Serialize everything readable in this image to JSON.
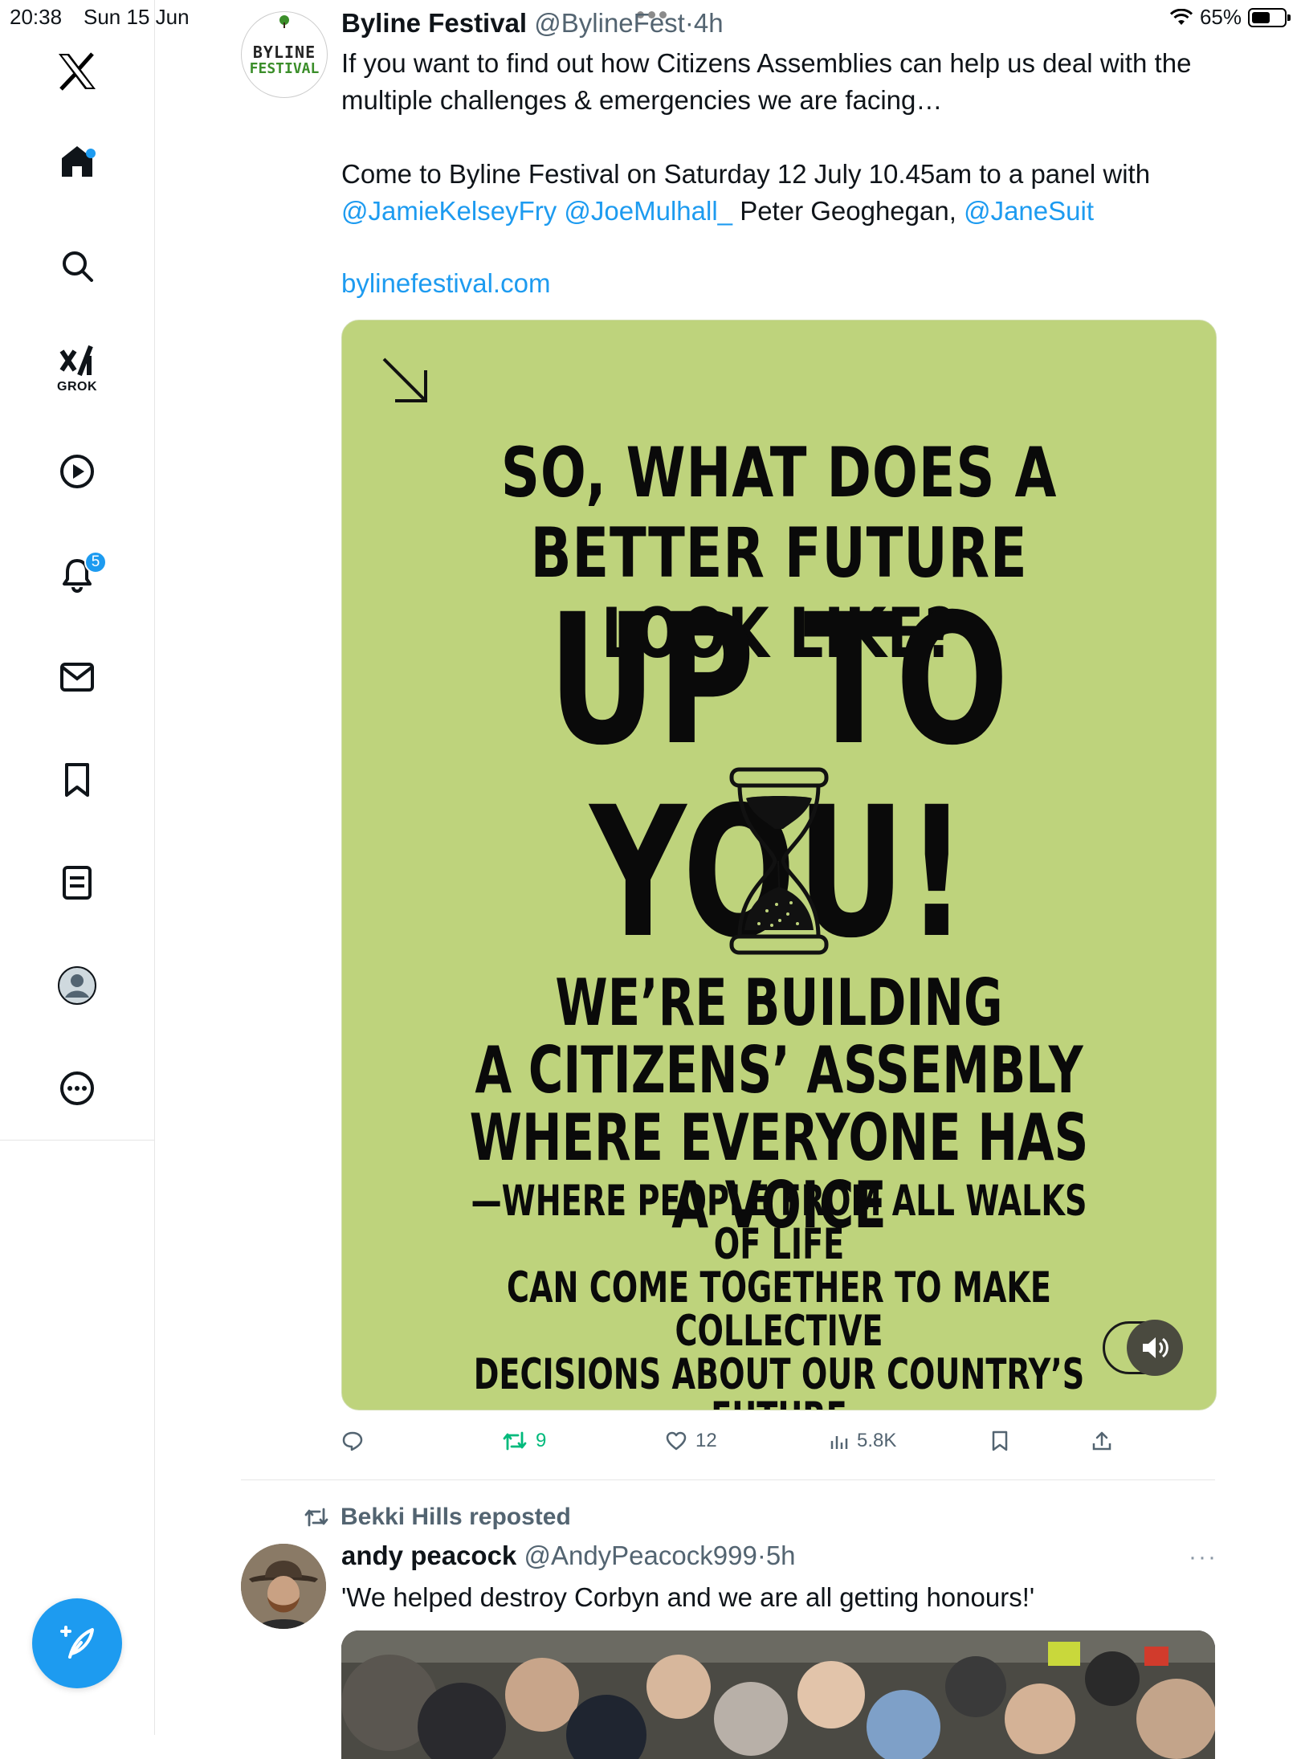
{
  "status_bar": {
    "time": "20:38",
    "date": "Sun 15 Jun",
    "battery": "65%",
    "battery_level": 0.65
  },
  "sidebar": {
    "items": [
      {
        "name": "home",
        "icon": "home-icon"
      },
      {
        "name": "search",
        "icon": "search-icon"
      },
      {
        "name": "grok",
        "icon": "grok-icon",
        "label": "GROK"
      },
      {
        "name": "video",
        "icon": "play-icon"
      },
      {
        "name": "notifications",
        "icon": "bell-icon",
        "badge": "5"
      },
      {
        "name": "messages",
        "icon": "mail-icon"
      },
      {
        "name": "bookmarks",
        "icon": "bookmark-icon"
      },
      {
        "name": "lists",
        "icon": "list-icon"
      },
      {
        "name": "profile",
        "icon": "profile-icon"
      },
      {
        "name": "more",
        "icon": "more-icon"
      }
    ],
    "compose_icon": "compose-icon",
    "accent": "#1d9bf0"
  },
  "tweet1": {
    "author_name": "Byline Festival",
    "handle": "@BylineFest",
    "separator": "·",
    "time": "4h",
    "avatar_text_top": "BYLINE",
    "avatar_text_bottom": "FESTIVAL",
    "text_line1": "If you want to find out how Citizens Assemblies can help us deal with the multiple challenges & emergencies we are facing…",
    "text_line2_pre": "Come to Byline Festival on Saturday 12 July 10.45am to a panel with",
    "mention1": "@JamieKelseyFry",
    "mention2": "@JoeMulhall_",
    "plain_name": "Peter Geoghegan,",
    "mention3": "@JaneSuit",
    "url": "bylinefestival.com",
    "media": {
      "background": "#bed37c",
      "headline": "SO, WHAT DOES A BETTER FUTURE LOOK LIKE?",
      "big": "UP TO YOU!",
      "mid_lines": [
        "WE’RE BUILDING",
        "A CITIZENS’ ASSEMBLY",
        "WHERE EVERYONE HAS A VOICE"
      ],
      "small_lines": [
        "—WHERE PEOPLE FROM ALL WALKS OF LIFE",
        "CAN COME TOGETHER TO MAKE COLLECTIVE",
        "DECISIONS ABOUT OUR COUNTRY’S FUTURE"
      ]
    },
    "actions": {
      "retweets": "9",
      "likes": "12",
      "views": "5.8K"
    }
  },
  "tweet2": {
    "reposted_by": "Bekki Hills reposted",
    "author_name": "andy peacock",
    "handle": "@AndyPeacock999",
    "separator": "·",
    "time": "5h",
    "text": "'We helped destroy Corbyn and we are all getting honours!'"
  }
}
